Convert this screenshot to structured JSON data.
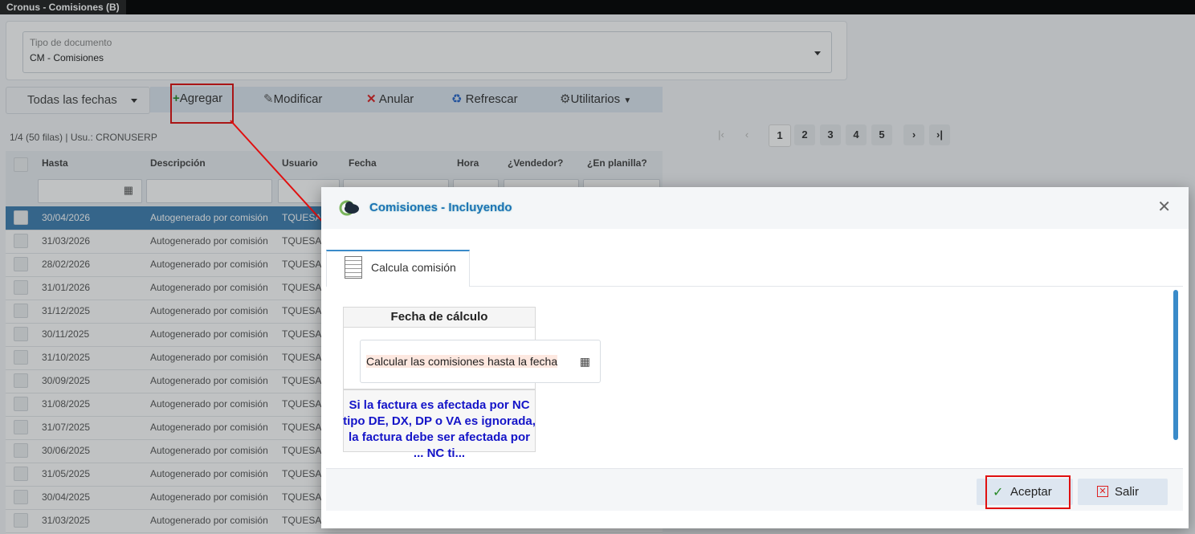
{
  "window": {
    "title": "Cronus - Comisiones (B)"
  },
  "document_type": {
    "label": "Tipo de documento",
    "value": "CM - Comisiones"
  },
  "toolbar": {
    "dates_label": "Todas las fechas",
    "add_label": "Agregar",
    "edit_label": "Modificar",
    "void_label": "Anular",
    "refresh_label": "Refrescar",
    "utilities_label": "Utilitarios"
  },
  "pager": {
    "info": "1/4 (50 filas) | Usu.: CRONUSERP",
    "pages": [
      "1",
      "2",
      "3",
      "4",
      "5"
    ]
  },
  "grid": {
    "columns": [
      "Hasta",
      "Descripción",
      "Usuario",
      "Fecha",
      "Hora",
      "¿Vendedor?",
      "¿En planilla?"
    ],
    "rows": [
      {
        "hasta": "30/04/2026",
        "descripcion": "Autogenerado por comisión",
        "usuario": "TQUESA"
      },
      {
        "hasta": "31/03/2026",
        "descripcion": "Autogenerado por comisión",
        "usuario": "TQUESA"
      },
      {
        "hasta": "28/02/2026",
        "descripcion": "Autogenerado por comisión",
        "usuario": "TQUESA"
      },
      {
        "hasta": "31/01/2026",
        "descripcion": "Autogenerado por comisión",
        "usuario": "TQUESA"
      },
      {
        "hasta": "31/12/2025",
        "descripcion": "Autogenerado por comisión",
        "usuario": "TQUESA"
      },
      {
        "hasta": "30/11/2025",
        "descripcion": "Autogenerado por comisión",
        "usuario": "TQUESA"
      },
      {
        "hasta": "31/10/2025",
        "descripcion": "Autogenerado por comisión",
        "usuario": "TQUESA"
      },
      {
        "hasta": "30/09/2025",
        "descripcion": "Autogenerado por comisión",
        "usuario": "TQUESA"
      },
      {
        "hasta": "31/08/2025",
        "descripcion": "Autogenerado por comisión",
        "usuario": "TQUESA"
      },
      {
        "hasta": "31/07/2025",
        "descripcion": "Autogenerado por comisión",
        "usuario": "TQUESA"
      },
      {
        "hasta": "30/06/2025",
        "descripcion": "Autogenerado por comisión",
        "usuario": "TQUESA"
      },
      {
        "hasta": "31/05/2025",
        "descripcion": "Autogenerado por comisión",
        "usuario": "TQUESA"
      },
      {
        "hasta": "30/04/2025",
        "descripcion": "Autogenerado por comisión",
        "usuario": "TQUESA"
      },
      {
        "hasta": "31/03/2025",
        "descripcion": "Autogenerado por comisión",
        "usuario": "TQUESA"
      }
    ]
  },
  "modal": {
    "title": "Comisiones - Incluyendo",
    "tab_label": "Calcula comisión",
    "fieldset_title": "Fecha de cálculo",
    "date_field_label": "Calcular las comisiones hasta la fecha",
    "note": "Si la factura es afectada por NC tipo DE, DX, DP o VA es ignorada, la factura debe ser afectada por ... NC ti...",
    "accept_label": "Aceptar",
    "exit_label": "Salir"
  },
  "colors": {
    "accent": "#1b73b5",
    "highlight_box": "#e01010",
    "selected_row": "#3f7fb0"
  }
}
